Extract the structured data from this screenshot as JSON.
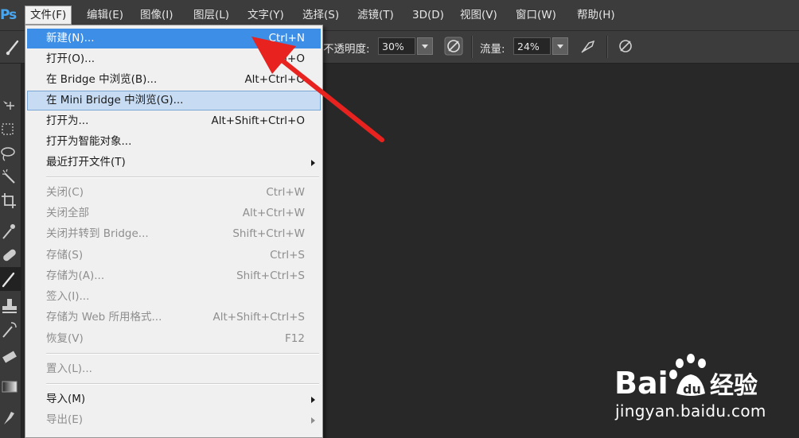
{
  "app": {
    "logo": "Ps"
  },
  "menubar": {
    "items": [
      {
        "label": "文件(F)",
        "open": true
      },
      {
        "label": "编辑(E)"
      },
      {
        "label": "图像(I)"
      },
      {
        "label": "图层(L)"
      },
      {
        "label": "文字(Y)"
      },
      {
        "label": "选择(S)"
      },
      {
        "label": "滤镜(T)"
      },
      {
        "label": "3D(D)"
      },
      {
        "label": "视图(V)"
      },
      {
        "label": "窗口(W)"
      },
      {
        "label": "帮助(H)"
      }
    ]
  },
  "options_bar": {
    "opacity_label": "不透明度:",
    "opacity_value": "30%",
    "flow_label": "流量:",
    "flow_value": "24%",
    "icons": [
      "brush-tool-icon",
      "pressure-opacity-icon",
      "airbrush-icon",
      "pressure-size-icon"
    ]
  },
  "toolbox": {
    "tools": [
      "move-tool-icon",
      "marquee-tool-icon",
      "lasso-tool-icon",
      "magic-wand-icon",
      "crop-tool-icon",
      "eyedropper-icon",
      "healing-brush-icon",
      "brush-tool-icon",
      "clone-stamp-icon",
      "history-brush-icon",
      "eraser-icon",
      "gradient-tool-icon",
      "smudge-tool-icon"
    ],
    "active": "brush-tool-icon"
  },
  "file_menu": {
    "items": [
      {
        "label": "新建(N)...",
        "shortcut": "Ctrl+N",
        "state": "highlighted"
      },
      {
        "label": "打开(O)...",
        "shortcut": "Ctrl+O"
      },
      {
        "label": "在 Bridge 中浏览(B)...",
        "shortcut": "Alt+Ctrl+O"
      },
      {
        "label": "在 Mini Bridge 中浏览(G)...",
        "shortcut": "",
        "state": "hover"
      },
      {
        "label": "打开为...",
        "shortcut": "Alt+Shift+Ctrl+O"
      },
      {
        "label": "打开为智能对象...",
        "shortcut": ""
      },
      {
        "label": "最近打开文件(T)",
        "shortcut": "",
        "submenu": true
      },
      {
        "label": "关闭(C)",
        "shortcut": "Ctrl+W",
        "disabled": true
      },
      {
        "label": "关闭全部",
        "shortcut": "Alt+Ctrl+W",
        "disabled": true
      },
      {
        "label": "关闭并转到 Bridge...",
        "shortcut": "Shift+Ctrl+W",
        "disabled": true
      },
      {
        "label": "存储(S)",
        "shortcut": "Ctrl+S",
        "disabled": true
      },
      {
        "label": "存储为(A)...",
        "shortcut": "Shift+Ctrl+S",
        "disabled": true
      },
      {
        "label": "签入(I)...",
        "shortcut": "",
        "disabled": true
      },
      {
        "label": "存储为 Web 所用格式...",
        "shortcut": "Alt+Shift+Ctrl+S",
        "disabled": true
      },
      {
        "label": "恢复(V)",
        "shortcut": "F12",
        "disabled": true
      },
      {
        "label": "置入(L)...",
        "shortcut": "",
        "disabled": true
      },
      {
        "label": "导入(M)",
        "shortcut": "",
        "submenu": true
      },
      {
        "label": "导出(E)",
        "shortcut": "",
        "submenu": true,
        "disabled": true
      }
    ]
  },
  "annotation": {
    "color": "#e8231f",
    "points_to": "新建(N)..."
  },
  "watermark": {
    "logo_text": "Bai",
    "logo_text_cn": "经验",
    "url": "jingyan.baidu.com"
  },
  "colors": {
    "highlight_blue": "#3d8ee6",
    "hover_light": "#c7dcf3",
    "menu_bg": "#f0f0f0",
    "canvas_bg": "#282828",
    "chrome_bg": "#3c3c3c",
    "arrow_red": "#e8231f",
    "ps_blue": "#49a6f0"
  }
}
